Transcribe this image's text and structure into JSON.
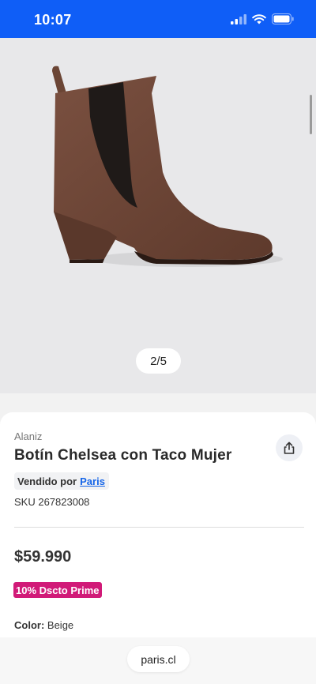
{
  "status_bar": {
    "time": "10:07",
    "icons": [
      "cellular-signal-icon",
      "wifi-icon",
      "battery-icon"
    ],
    "background": "#0f5ef7"
  },
  "gallery": {
    "image": "brown-suede-chelsea-boot",
    "pager": "2/5"
  },
  "product": {
    "brand": "Alaniz",
    "title": "Botín Chelsea con Taco Mujer",
    "seller_prefix": "Vendido por",
    "seller_name": "Paris",
    "sku": "SKU 267823008",
    "price": "$59.990",
    "prime_badge": "10% Dscto Prime",
    "color_label": "Color:",
    "color_value": "Beige"
  },
  "bottom_bar": {
    "url": "paris.cl"
  },
  "colors": {
    "accent": "#0f5ef7",
    "prime": "#d11a78",
    "link": "#1565e8"
  }
}
